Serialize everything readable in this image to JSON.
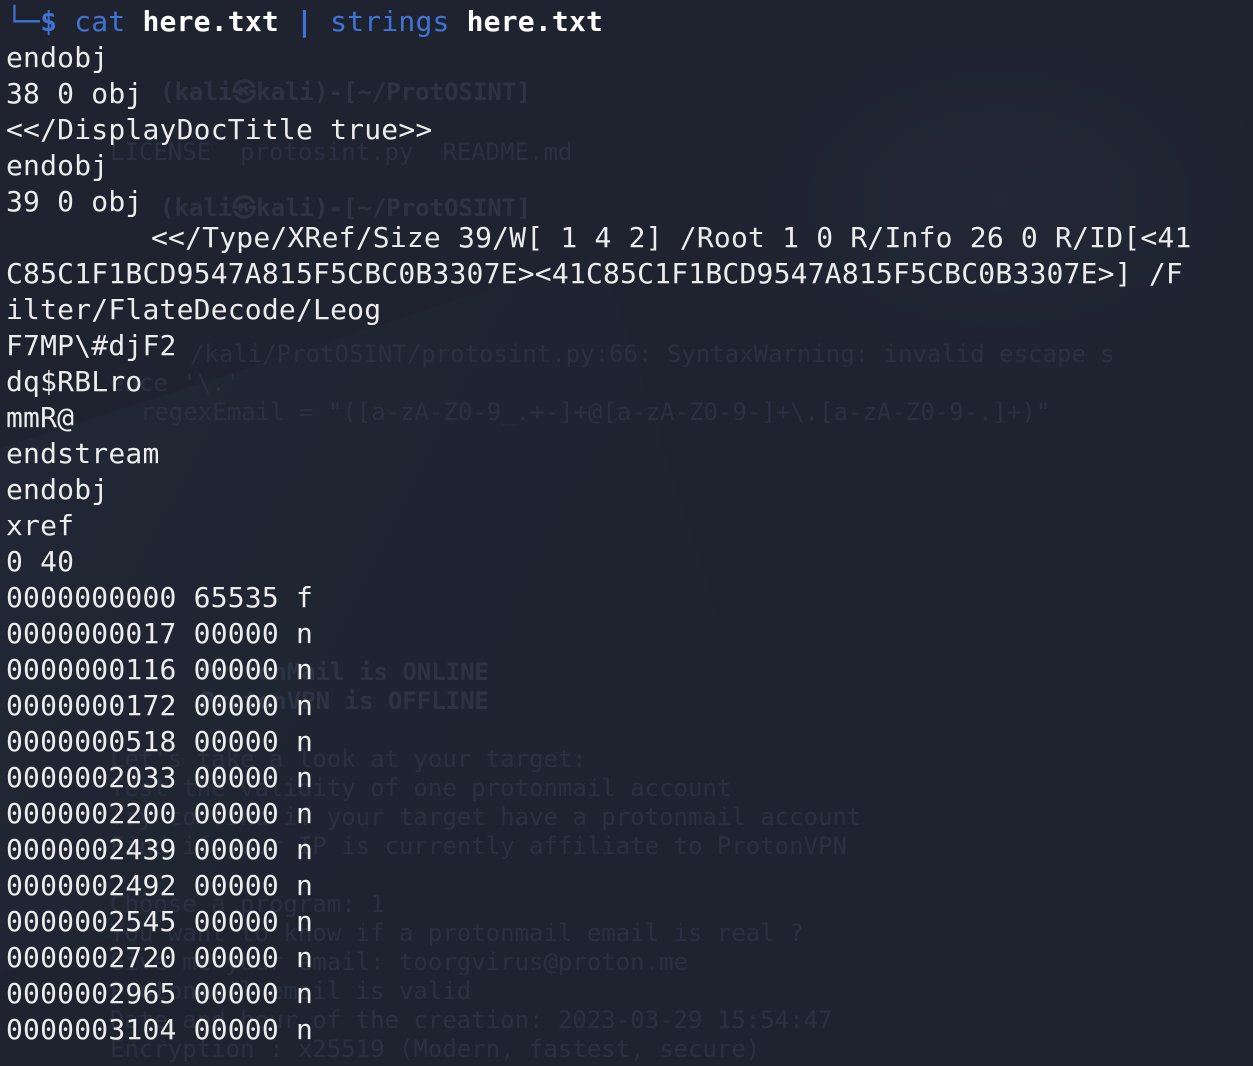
{
  "prompt": {
    "corner": "└─",
    "symbol": "$",
    "command1": "cat",
    "arg1": "here.txt",
    "pipe": "|",
    "command2": "strings",
    "arg2": "here.txt"
  },
  "output_lines": [
    "endobj",
    "38 0 obj",
    "<</DisplayDocTitle true>>",
    "endobj",
    "39 0 obj",
    "<</Type/XRef/Size 39/W[ 1 4 2] /Root 1 0 R/Info 26 0 R/ID[<41",
    "C85C1F1BCD9547A815F5CBC0B3307E><41C85C1F1BCD9547A815F5CBC0B3307E>] /F",
    "ilter/FlateDecode/Leog",
    "F7MP\\#djF2",
    "dq$RBLro",
    "mmR@",
    "endstream",
    "endobj",
    "xref",
    "0 40",
    "0000000000 65535 f",
    "0000000017 00000 n",
    "0000000116 00000 n",
    "0000000172 00000 n",
    "0000000518 00000 n",
    "0000002033 00000 n",
    "0000002200 00000 n",
    "0000002439 00000 n",
    "0000002492 00000 n",
    "0000002545 00000 n",
    "0000002720 00000 n",
    "0000002965 00000 n",
    "0000003104 00000 n"
  ],
  "background_text": [
    "(kali㉿kali)-[~/ProtOSINT]",
    "LICENSE  protosint.py  README.md",
    "(kali㉿kali)-[~/ProtOSINT]",
    "/kali/ProtOSINT/protosint.py:66: SyntaxWarning: invalid escape s",
    "ence '\\.'",
    "regexEmail = \"([a-zA-Z0-9_.+-]+@[a-zA-Z0-9-]+\\.[a-zA-Z0-9-.]+)\"",
    "ProtonMail is ONLINE",
    "ProtonVPN is OFFLINE",
    "Let's take a look at your target:",
    "Test the validity of one protonmail account",
    "Try to find if your target have a protonmail account",
    "Find if your IP is currently affiliate to ProtonVPN",
    "Choose a program: 1",
    "You want to know if a protonmail email is real ?",
    "Give me your email: toorgvirus@proton.me",
    "Protonmail email is valid",
    "Date and hour of the creation: 2023-03-29 15:54:47",
    "Encryption : x25519 (Modern, fastest, secure)"
  ],
  "colors": {
    "background": "#1f2330",
    "text": "#ececec",
    "prompt_accent": "#3f73d6",
    "ghost_text": "#2b3040"
  }
}
